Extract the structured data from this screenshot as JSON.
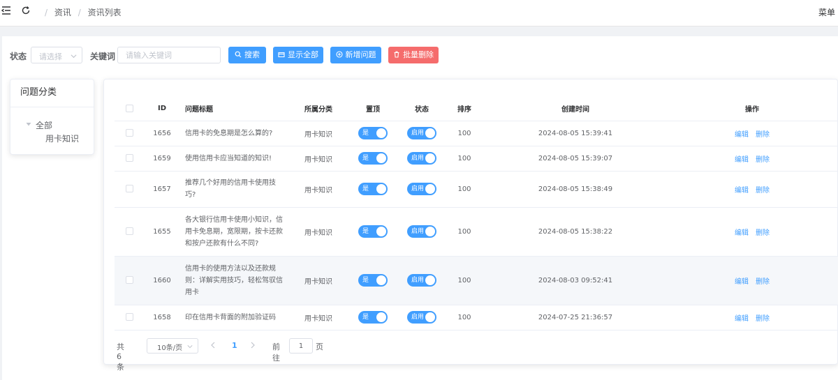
{
  "breadcrumb": {
    "sep": "/",
    "items": [
      "资讯",
      "资讯列表"
    ]
  },
  "header": {
    "menu_label": "菜单"
  },
  "filters": {
    "status_label": "状态",
    "status_placeholder": "请选择",
    "keyword_label": "关键词",
    "keyword_placeholder": "请输入关键词",
    "keyword_value": ""
  },
  "actions": {
    "search": "搜索",
    "show_all": "显示全部",
    "add": "新增问题",
    "batch_delete": "批量删除"
  },
  "categories": {
    "title": "问题分类",
    "root": "全部",
    "child": "用卡知识"
  },
  "table": {
    "columns": [
      "ID",
      "问题标题",
      "所属分类",
      "置顶",
      "状态",
      "排序",
      "创建时间",
      "操作"
    ],
    "rows": [
      {
        "id": "1656",
        "title": "信用卡的免息期是怎么算的?",
        "category": "用卡知识",
        "top": "是",
        "status": "启用",
        "sort": "100",
        "created": "2024-08-05 15:39:41"
      },
      {
        "id": "1659",
        "title": "使用信用卡应当知道的知识!",
        "category": "用卡知识",
        "top": "是",
        "status": "启用",
        "sort": "100",
        "created": "2024-08-05 15:39:07"
      },
      {
        "id": "1657",
        "title": "推荐几个好用的信用卡使用技巧?",
        "category": "用卡知识",
        "top": "是",
        "status": "启用",
        "sort": "100",
        "created": "2024-08-05 15:38:49"
      },
      {
        "id": "1655",
        "title": "各大银行信用卡使用小知识，信用卡免息期，宽限期，按卡还款和按户还款有什么不同?",
        "category": "用卡知识",
        "top": "是",
        "status": "启用",
        "sort": "100",
        "created": "2024-08-05 15:38:22"
      },
      {
        "id": "1660",
        "title": "信用卡的使用方法以及还款规则：详解实用技巧，轻松驾驭信用卡",
        "category": "用卡知识",
        "top": "是",
        "status": "启用",
        "sort": "100",
        "created": "2024-08-03 09:52:41"
      },
      {
        "id": "1658",
        "title": "印在信用卡背面的附加验证码",
        "category": "用卡知识",
        "top": "是",
        "status": "启用",
        "sort": "100",
        "created": "2024-07-25 21:36:57"
      }
    ],
    "edit_label": "编辑",
    "delete_label": "删除",
    "highlighted_row": 4
  },
  "pagination": {
    "total": "共 6 条",
    "page_size": "10条/页",
    "current": "1",
    "goto_label": "前往",
    "goto_value": "1",
    "page_unit": "页"
  },
  "colors": {
    "primary": "#409eff",
    "danger": "#f56c6c",
    "background": "#f0f2f5"
  }
}
